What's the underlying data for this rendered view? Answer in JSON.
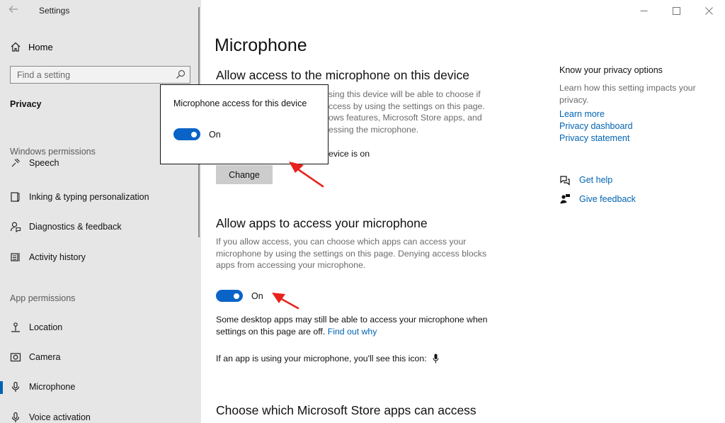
{
  "window": {
    "app_title": "Settings",
    "controls": {
      "minimize": "—",
      "maximize": "☐",
      "close": "✕"
    }
  },
  "sidebar": {
    "home_label": "Home",
    "search_placeholder": "Find a setting",
    "section": "Privacy",
    "windows_permissions_heading": "Windows permissions",
    "windows_items": [
      {
        "label": "Speech",
        "icon": "speech-icon"
      },
      {
        "label": "Inking & typing personalization",
        "icon": "inking-icon"
      },
      {
        "label": "Diagnostics & feedback",
        "icon": "diagnostics-icon"
      },
      {
        "label": "Activity history",
        "icon": "activity-icon"
      }
    ],
    "app_permissions_heading": "App permissions",
    "app_items": [
      {
        "label": "Location",
        "icon": "location-icon"
      },
      {
        "label": "Camera",
        "icon": "camera-icon"
      },
      {
        "label": "Microphone",
        "icon": "microphone-icon",
        "selected": true
      },
      {
        "label": "Voice activation",
        "icon": "voice-activation-icon"
      }
    ]
  },
  "main": {
    "page_title": "Microphone",
    "device_section": {
      "heading": "Allow access to the microphone on this device",
      "desc_line1": "sing this device will be able to choose if",
      "desc_line2": "ccess by using the settings on this page.",
      "desc_line3": "ows features, Microsoft Store apps, and",
      "desc_line4": "essing the microphone.",
      "status": "evice is on",
      "change_button": "Change"
    },
    "popup": {
      "title": "Microphone access for this device",
      "toggle_state": "On"
    },
    "apps_section": {
      "heading": "Allow apps to access your microphone",
      "desc_line1": "If you allow access, you can choose which apps can access your",
      "desc_line2": "microphone by using the settings on this page. Denying access blocks",
      "desc_line3": "apps from accessing your microphone.",
      "toggle_state": "On",
      "note_line1": "Some desktop apps may still be able to access your microphone when",
      "note_line2": "settings on this page are off.",
      "find_out_why": "Find out why",
      "icon_note": "If an app is using your microphone, you'll see this icon:"
    },
    "store_section": {
      "heading": "Choose which Microsoft Store apps can access"
    }
  },
  "right_panel": {
    "title": "Know your privacy options",
    "description": "Learn how this setting impacts your privacy.",
    "links": [
      "Learn more",
      "Privacy dashboard",
      "Privacy statement"
    ],
    "get_help": "Get help",
    "give_feedback": "Give feedback"
  },
  "colors": {
    "accent": "#0063b1",
    "toggle_on": "#0a64c8",
    "sidebar_bg": "#e6e6e6",
    "annotation_arrow": "#e8231e"
  }
}
